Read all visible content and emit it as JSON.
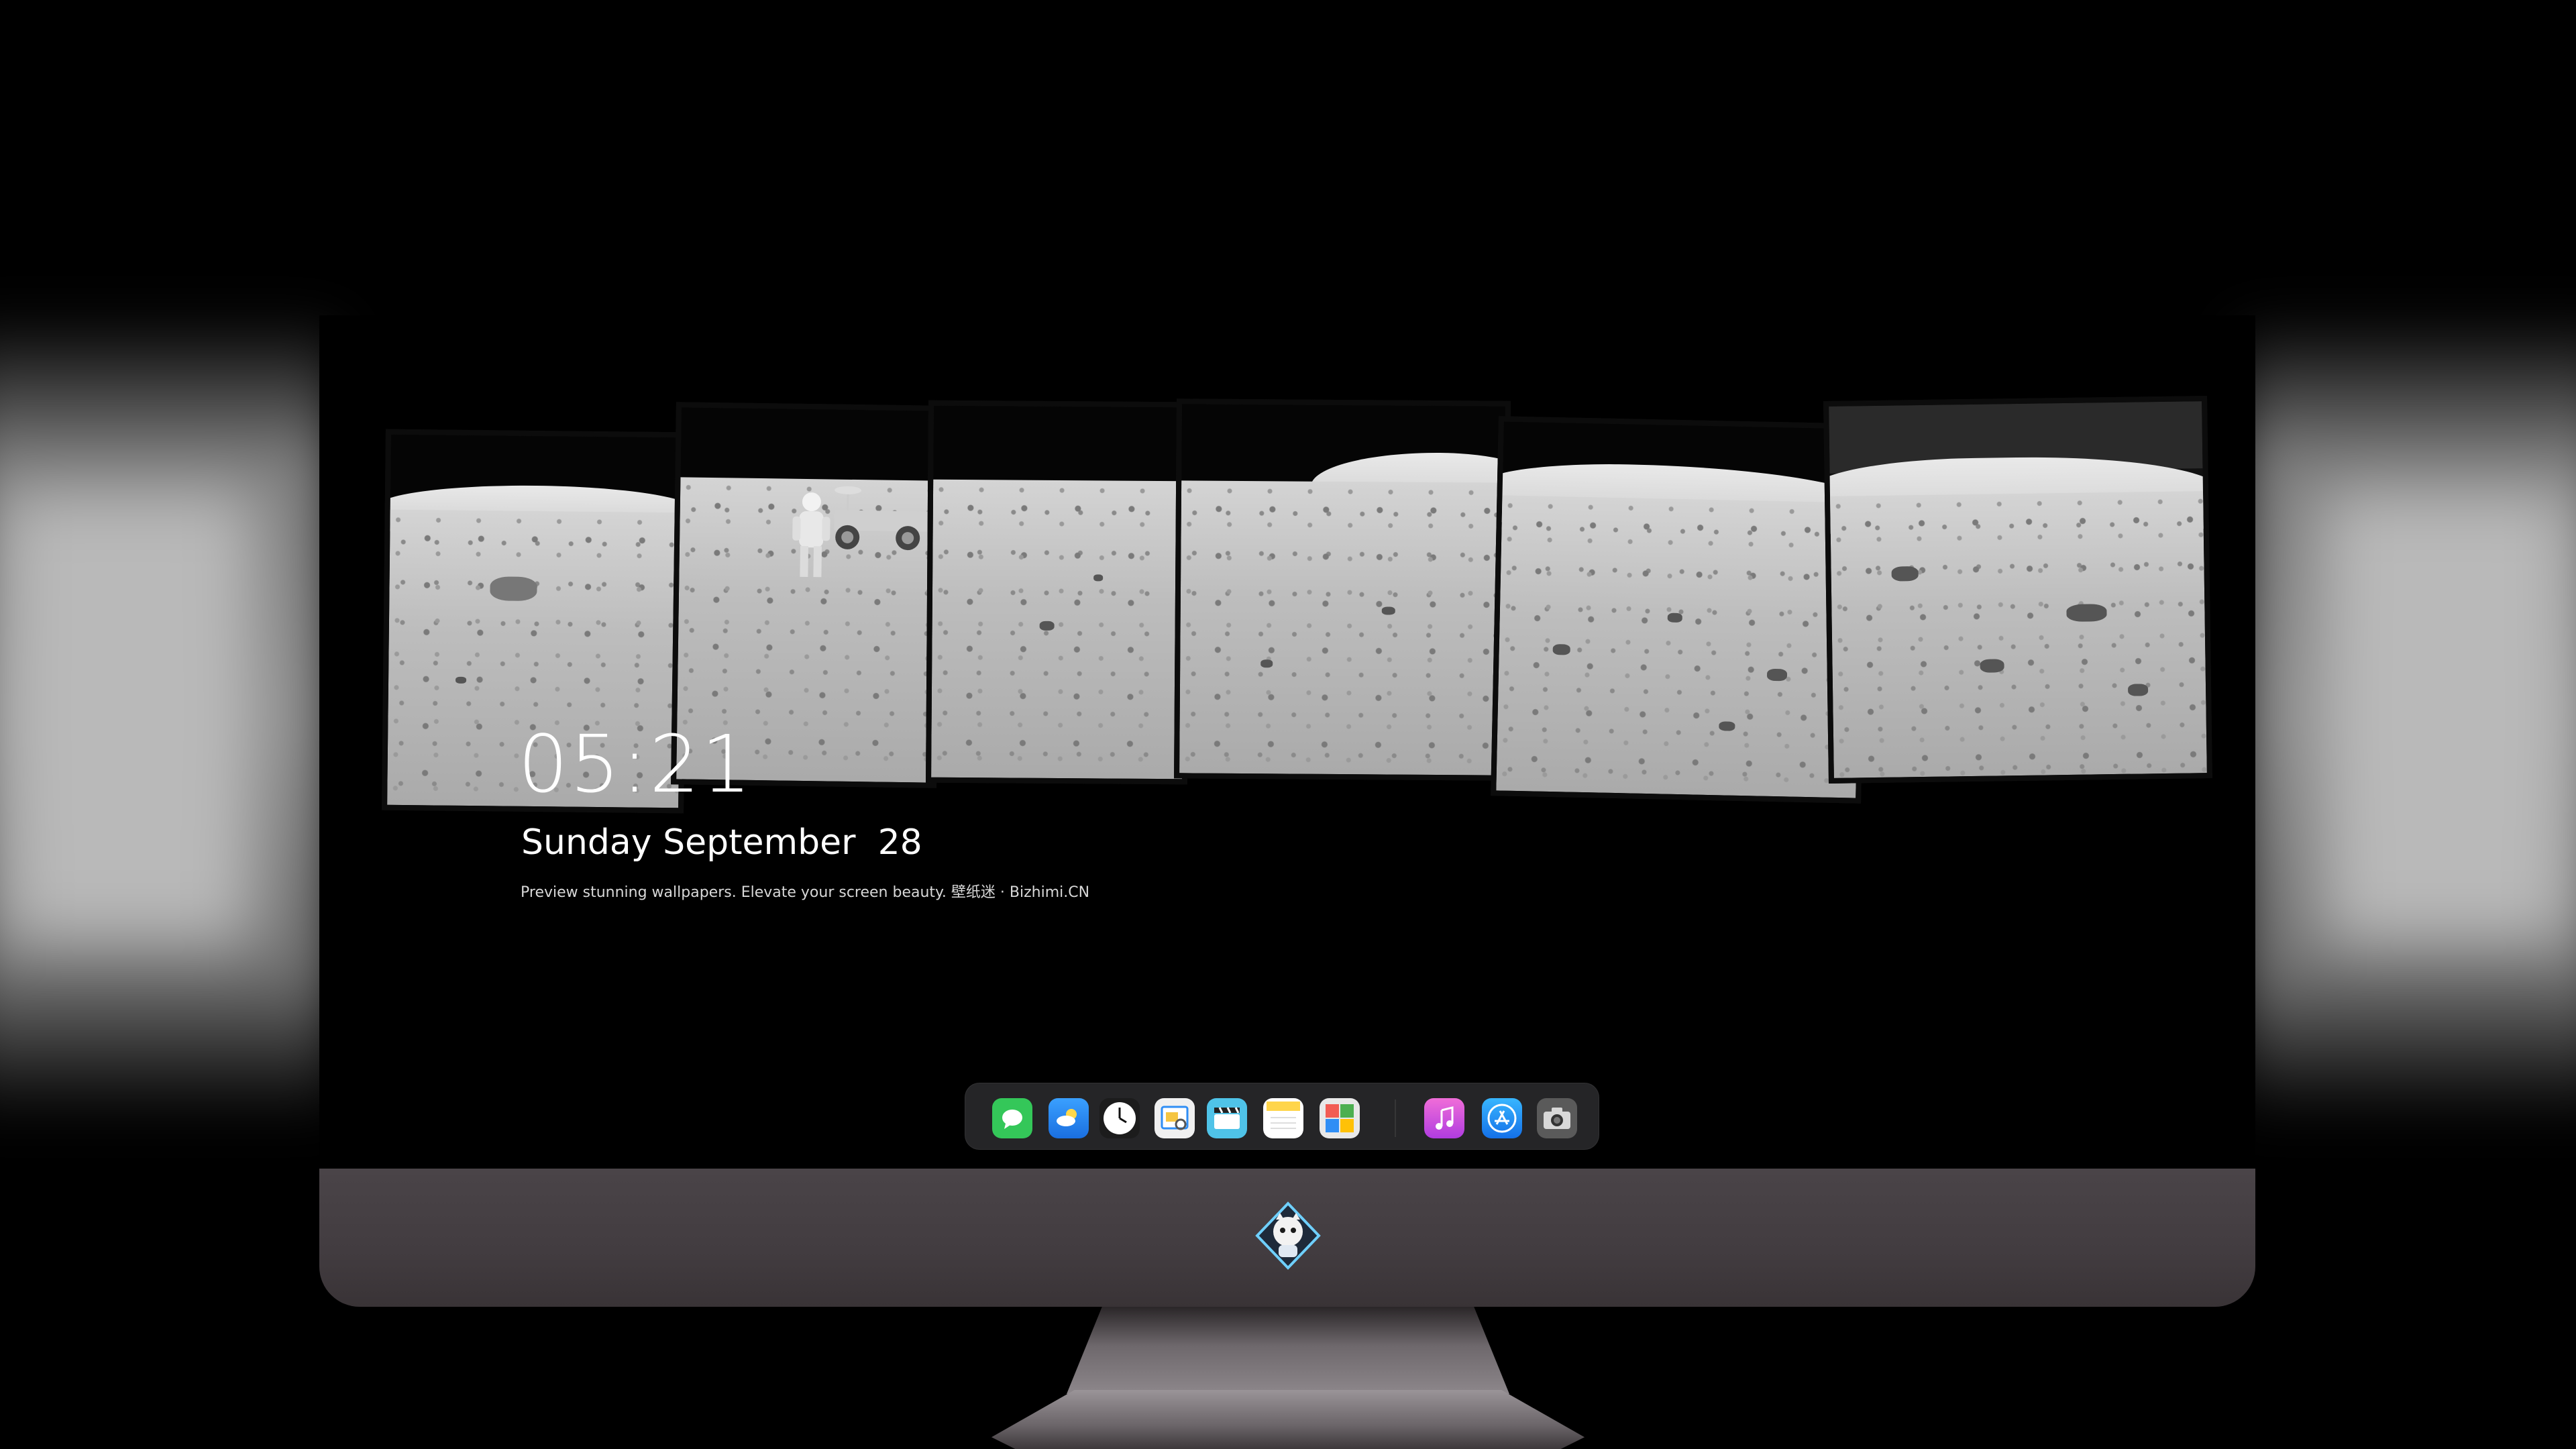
{
  "desktop": {
    "clock": {
      "time": "05:21"
    },
    "date": {
      "text": "Sunday September  28"
    },
    "tagline": "Preview stunning wallpapers. Elevate your screen beauty. 壁纸迷 · Bizhimi.CN",
    "wallpaper": {
      "subject": "lunar-surface-panorama",
      "colors": {
        "sky": "#050505",
        "ground": "#bdbdbd",
        "hills": "#e0e0e0"
      }
    }
  },
  "dock": {
    "apps": [
      {
        "name": "Messages",
        "icon": "messages-icon",
        "color": "#34c759"
      },
      {
        "name": "Weather",
        "icon": "weather-icon",
        "color": "#2f8ef5"
      },
      {
        "name": "Clock",
        "icon": "clock-icon",
        "color": "#ffffff"
      },
      {
        "name": "Preview",
        "icon": "preview-icon",
        "color": "#f5c542"
      },
      {
        "name": "Clips",
        "icon": "clips-icon",
        "color": "#4fc3e8"
      },
      {
        "name": "Notes",
        "icon": "notes-icon",
        "color": "#ffd54a"
      },
      {
        "name": "Photo Booth",
        "icon": "photo-booth-icon",
        "color": "#e8e8e8"
      },
      {
        "name": "iTunes",
        "icon": "itunes-icon",
        "color": "#d455e8"
      },
      {
        "name": "App Store",
        "icon": "app-store-icon",
        "color": "#1c8cf5"
      },
      {
        "name": "Screenshot",
        "icon": "camera-icon",
        "color": "#8a8a8a"
      }
    ]
  },
  "monitor": {
    "logo": "bizhimi-mascot-logo",
    "colors": {
      "chin": "#433d41",
      "stand": "#8d878b"
    }
  }
}
